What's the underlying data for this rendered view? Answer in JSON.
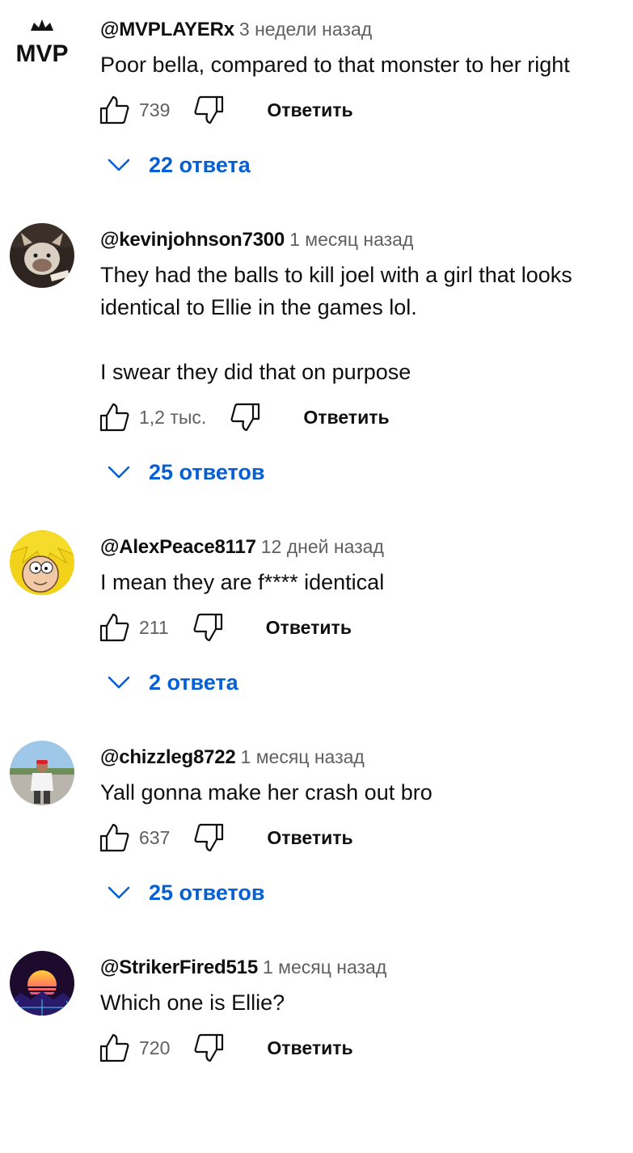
{
  "reply_label": "Ответить",
  "accent_color": "#065fd4",
  "comments": [
    {
      "handle": "@MVPLAYERx",
      "time": "3 недели назад",
      "text": [
        "Poor bella, compared to that monster to her right"
      ],
      "likes": "739",
      "replies": "22 ответа",
      "avatar": "mvp-logo-avatar",
      "avatar_text": "MVP"
    },
    {
      "handle": "@kevinjohnson7300",
      "time": "1 месяц назад",
      "text": [
        "They had the balls to kill joel with a girl that looks identical to Ellie in the games lol.",
        "I swear they did that on purpose"
      ],
      "likes": "1,2 тыс.",
      "replies": "25 ответов",
      "avatar": "dog-photo-avatar"
    },
    {
      "handle": "@AlexPeace8117",
      "time": "12 дней назад",
      "text": [
        "I mean they are f**** identical"
      ],
      "likes": "211",
      "replies": "2 ответа",
      "avatar": "cartoon-face-avatar"
    },
    {
      "handle": "@chizzleg8722",
      "time": "1 месяц назад",
      "text": [
        "Yall gonna make her crash out bro"
      ],
      "likes": "637",
      "replies": "25 ответов",
      "avatar": "person-photo-avatar"
    },
    {
      "handle": "@StrikerFired515",
      "time": "1 месяц назад",
      "text": [
        "Which one is Ellie?"
      ],
      "likes": "720",
      "avatar": "synthwave-sunset-avatar"
    }
  ]
}
